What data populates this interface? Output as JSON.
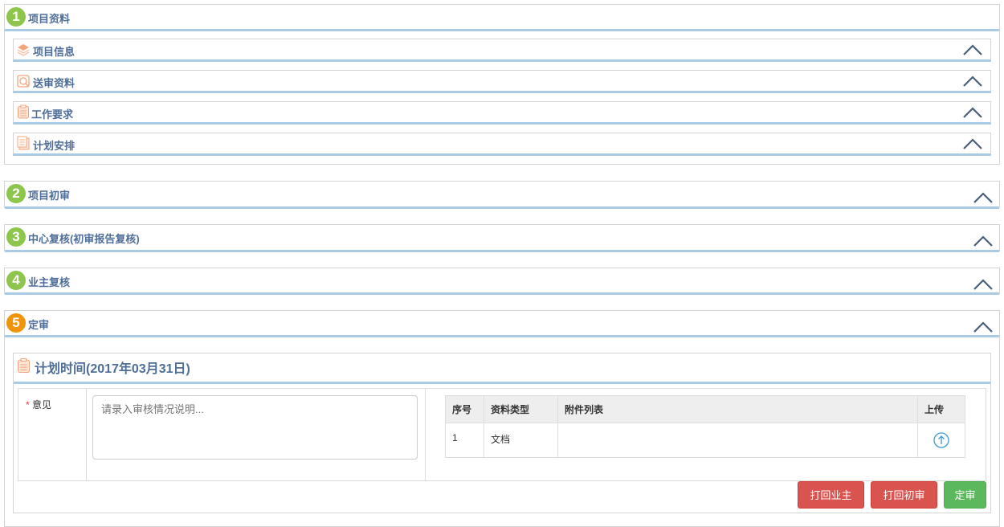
{
  "sections": [
    {
      "number": "1",
      "title": "项目资料",
      "color": "#8dc54d"
    },
    {
      "number": "2",
      "title": "项目初审",
      "color": "#8dc54d"
    },
    {
      "number": "3",
      "title": "中心复核(初审报告复核)",
      "color": "#8dc54d"
    },
    {
      "number": "4",
      "title": "业主复核",
      "color": "#8dc54d"
    },
    {
      "number": "5",
      "title": "定审",
      "color": "#f0940a"
    }
  ],
  "subsections": [
    {
      "title": "项目信息",
      "icon": "layers-icon"
    },
    {
      "title": "送审资料",
      "icon": "search-doc-icon"
    },
    {
      "title": "工作要求",
      "icon": "clipboard-icon"
    },
    {
      "title": "计划安排",
      "icon": "document-list-icon"
    }
  ],
  "final": {
    "plan_title": "计划时间(2017年03月31日)",
    "required_mark": "*",
    "opinion_label": "意见",
    "opinion_placeholder": "请录入审核情况说明...",
    "opinion_value": "",
    "table": {
      "headers": [
        "序号",
        "资料类型",
        "附件列表",
        "上传"
      ],
      "rows": [
        {
          "index": "1",
          "type": "文档",
          "attachments": ""
        }
      ]
    },
    "buttons": {
      "return_owner": "打回业主",
      "return_initial": "打回初审",
      "approve": "定审"
    }
  }
}
